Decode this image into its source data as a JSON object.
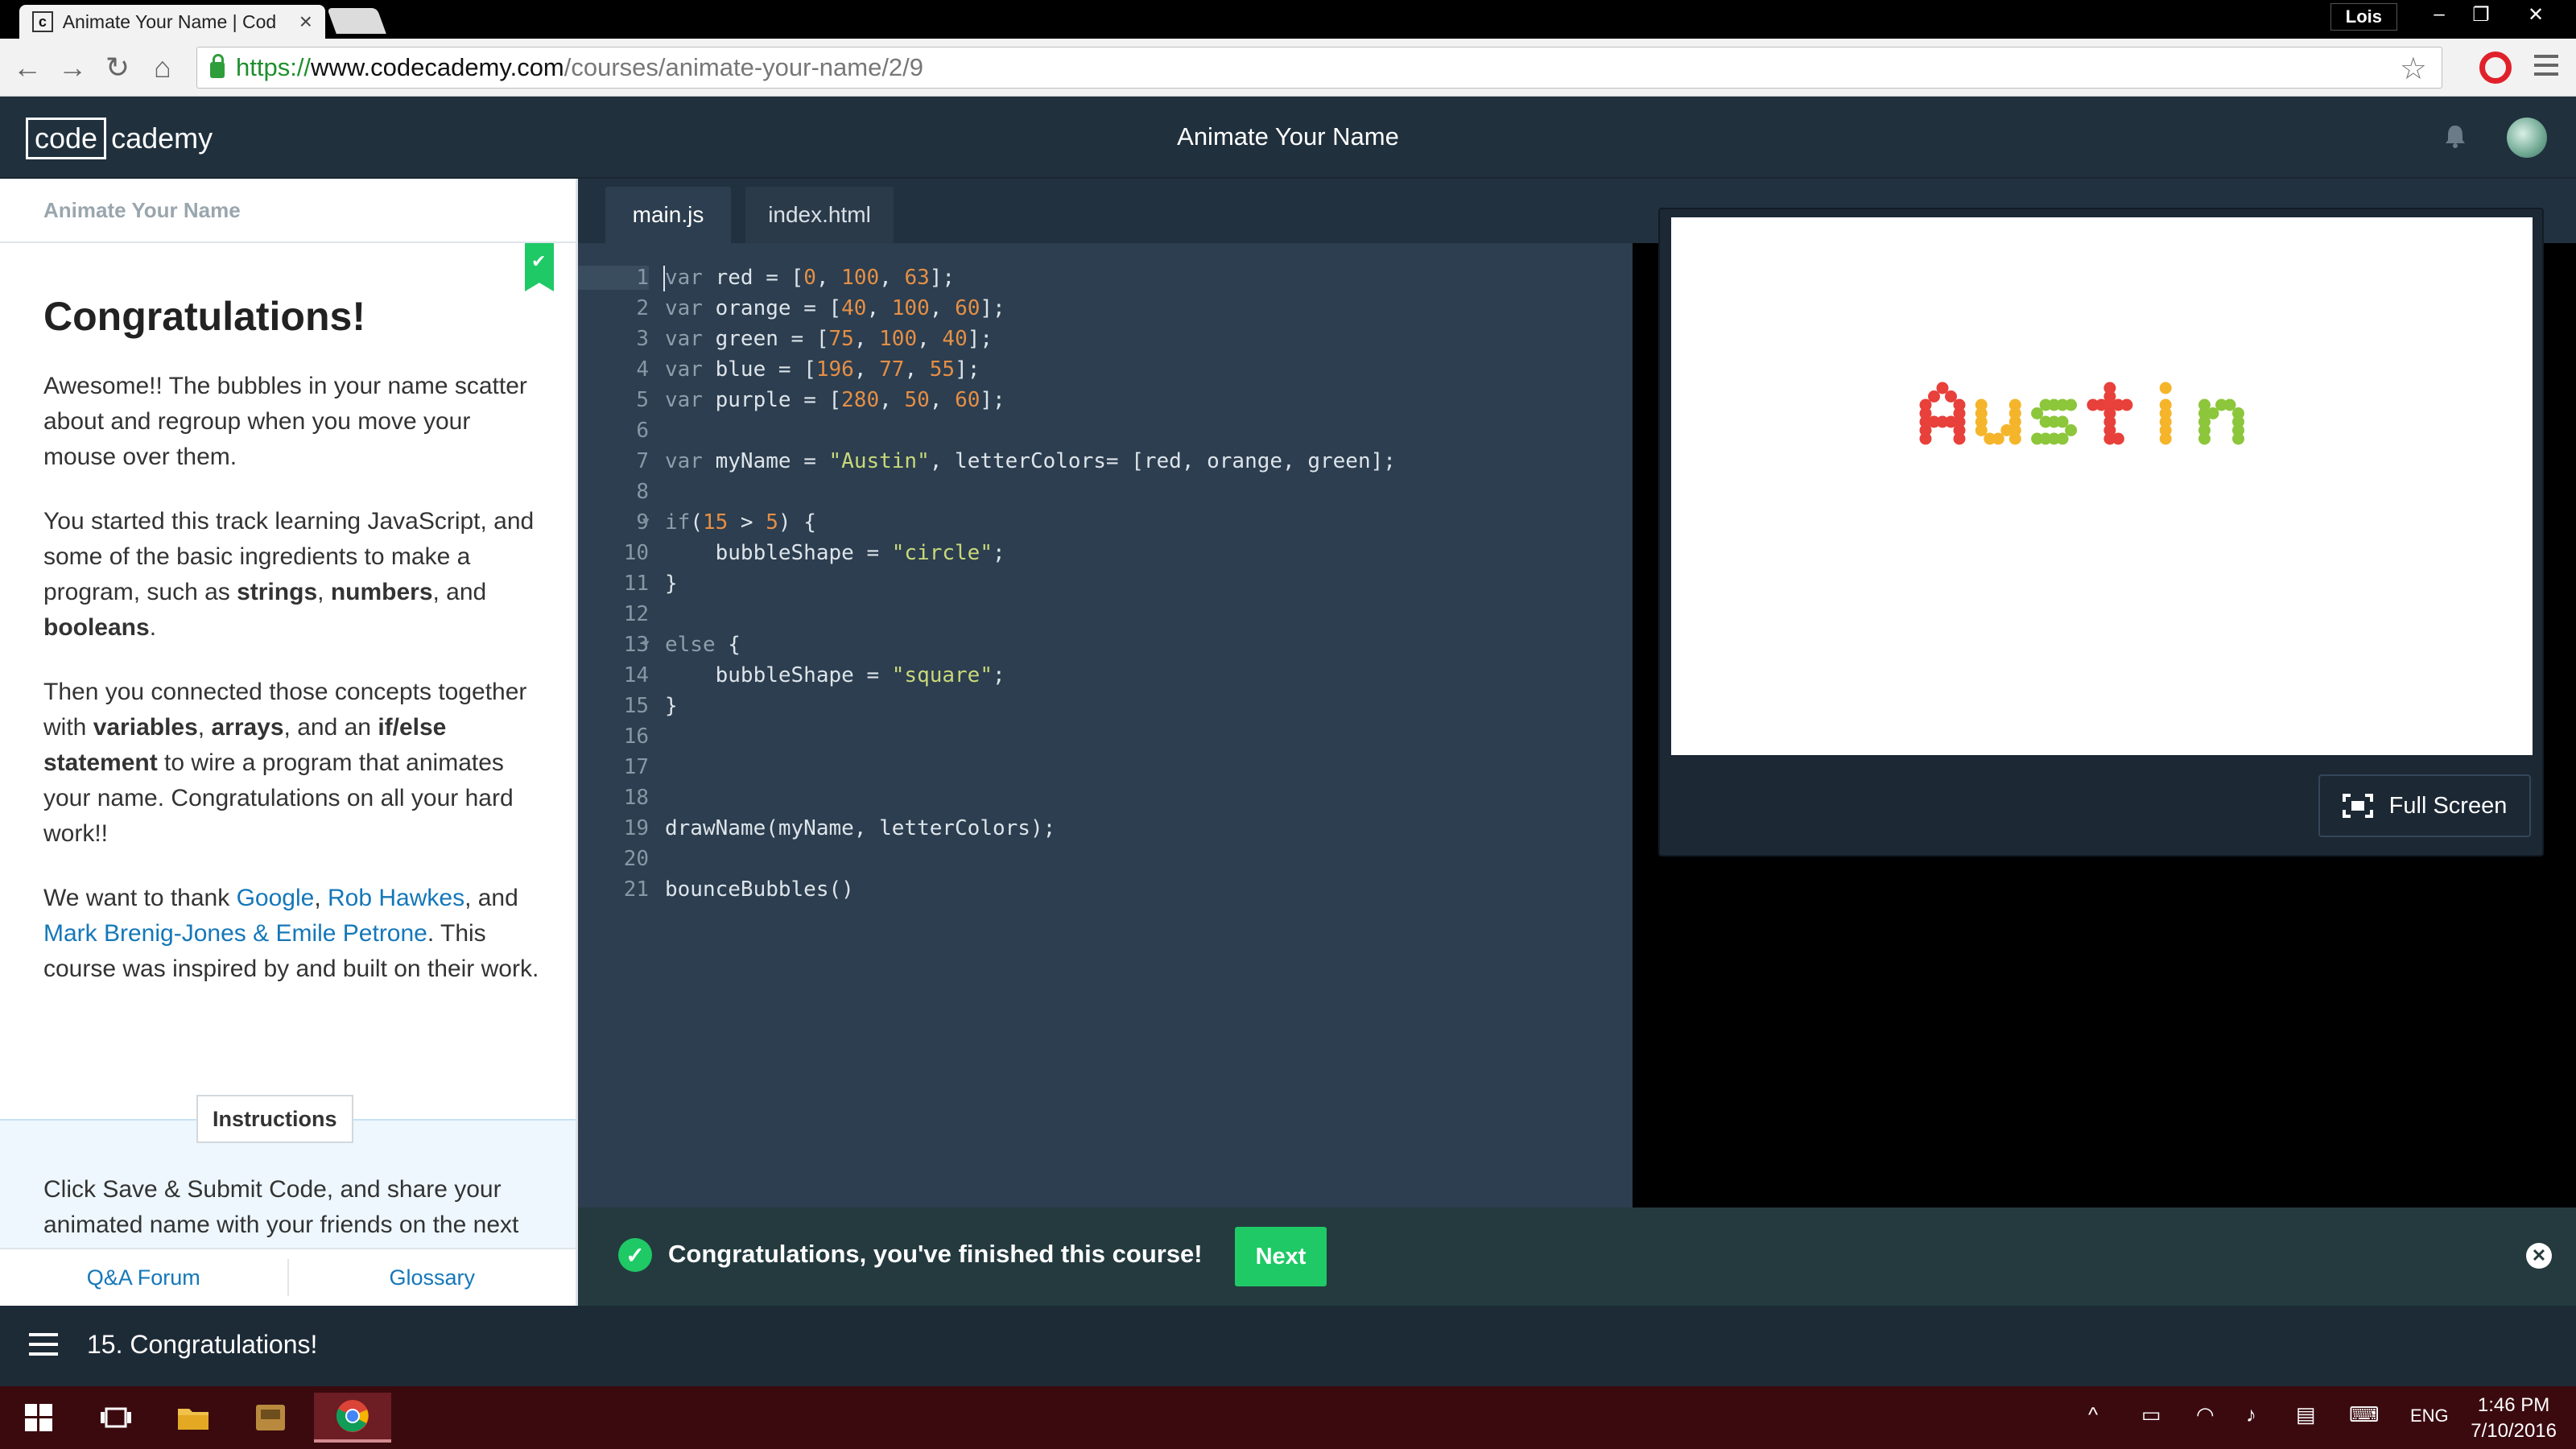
{
  "browser": {
    "tab_title": "Animate Your Name | Cod",
    "tab_favicon": "c",
    "user": "Lois",
    "url_scheme": "https://",
    "url_host": "www.codecademy.com",
    "url_path": "/courses/animate-your-name/2/9"
  },
  "header": {
    "logo_box": "code",
    "logo_rest": "cademy",
    "title": "Animate Your Name"
  },
  "lesson": {
    "panel_title": "Animate Your Name",
    "heading": "Congratulations!",
    "p1": "Awesome!! The bubbles in your name scatter about and regroup when you move your mouse over them.",
    "p2_pre": "You started this track learning JavaScript, and some of the basic ingredients to make a program, such as ",
    "p2_b1": "strings",
    "p2_sep1": ", ",
    "p2_b2": "numbers",
    "p2_sep2": ", and ",
    "p2_b3": "booleans",
    "p2_end": ".",
    "p3_pre": "Then you connected those concepts together with ",
    "p3_b1": "variables",
    "p3_sep1": ", ",
    "p3_b2": "arrays",
    "p3_sep2": ", and an ",
    "p3_b3": "if/else statement",
    "p3_end": " to wire a program that animates your name. Congratulations on all your hard work!!",
    "p4_pre": "We want to thank ",
    "p4_l1": "Google",
    "p4_sep1": ", ",
    "p4_l2": "Rob Hawkes",
    "p4_sep2": ", and ",
    "p4_l3": "Mark Brenig-Jones & Emile Petrone",
    "p4_end": ". This course was inspired by and built on their work.",
    "instructions_tab": "Instructions",
    "instructions_text": "Click Save & Submit Code, and share your animated name with your friends on the next panel!",
    "qa_link": "Q&A Forum",
    "glossary_link": "Glossary"
  },
  "editor": {
    "tabs": [
      "main.js",
      "index.html"
    ],
    "line_numbers": [
      "1",
      "2",
      "3",
      "4",
      "5",
      "6",
      "7",
      "8",
      "9",
      "10",
      "11",
      "12",
      "13",
      "14",
      "15",
      "16",
      "17",
      "18",
      "19",
      "20",
      "21"
    ],
    "code": {
      "l1": {
        "kw": "var",
        "a": " red = [",
        "n1": "0",
        "s1": ", ",
        "n2": "100",
        "s2": ", ",
        "n3": "63",
        "e": "];"
      },
      "l2": {
        "kw": "var",
        "a": " orange = [",
        "n1": "40",
        "s1": ", ",
        "n2": "100",
        "s2": ", ",
        "n3": "60",
        "e": "];"
      },
      "l3": {
        "kw": "var",
        "a": " green = [",
        "n1": "75",
        "s1": ", ",
        "n2": "100",
        "s2": ", ",
        "n3": "40",
        "e": "];"
      },
      "l4": {
        "kw": "var",
        "a": " blue = [",
        "n1": "196",
        "s1": ", ",
        "n2": "77",
        "s2": ", ",
        "n3": "55",
        "e": "];"
      },
      "l5": {
        "kw": "var",
        "a": " purple = [",
        "n1": "280",
        "s1": ", ",
        "n2": "50",
        "s2": ", ",
        "n3": "60",
        "e": "];"
      },
      "l7": {
        "kw": "var",
        "a": " myName = ",
        "str": "\"Austin\"",
        "e": ", letterColors= [red, orange, green];"
      },
      "l9": {
        "kw": "if",
        "a": "(",
        "n1": "15",
        "s1": " > ",
        "n2": "5",
        "e": ") {"
      },
      "l10": {
        "a": "    bubbleShape = ",
        "str": "\"circle\"",
        "e": ";"
      },
      "l11": "}",
      "l13": {
        "kw": "else",
        "e": " {"
      },
      "l14": {
        "a": "    bubbleShape = ",
        "str": "\"square\"",
        "e": ";"
      },
      "l15": "}",
      "l19": "drawName(myName, letterColors);",
      "l21": "bounceBubbles()"
    }
  },
  "preview": {
    "name_rendered": "Austin",
    "letter_colors": [
      "#e8403a",
      "#f5b52b",
      "#8cc63a"
    ],
    "fullscreen_label": "Full Screen"
  },
  "banner": {
    "message": "Congratulations, you've finished this course!",
    "next_label": "Next"
  },
  "course_nav": {
    "current_lesson": "15. Congratulations!"
  },
  "taskbar": {
    "language": "ENG",
    "time": "1:46 PM",
    "date": "7/10/2016"
  },
  "colors": {
    "accent_green": "#1fc966",
    "header_bg": "#20303d",
    "editor_bg": "#2c3e4f",
    "link_blue": "#1477b9"
  }
}
